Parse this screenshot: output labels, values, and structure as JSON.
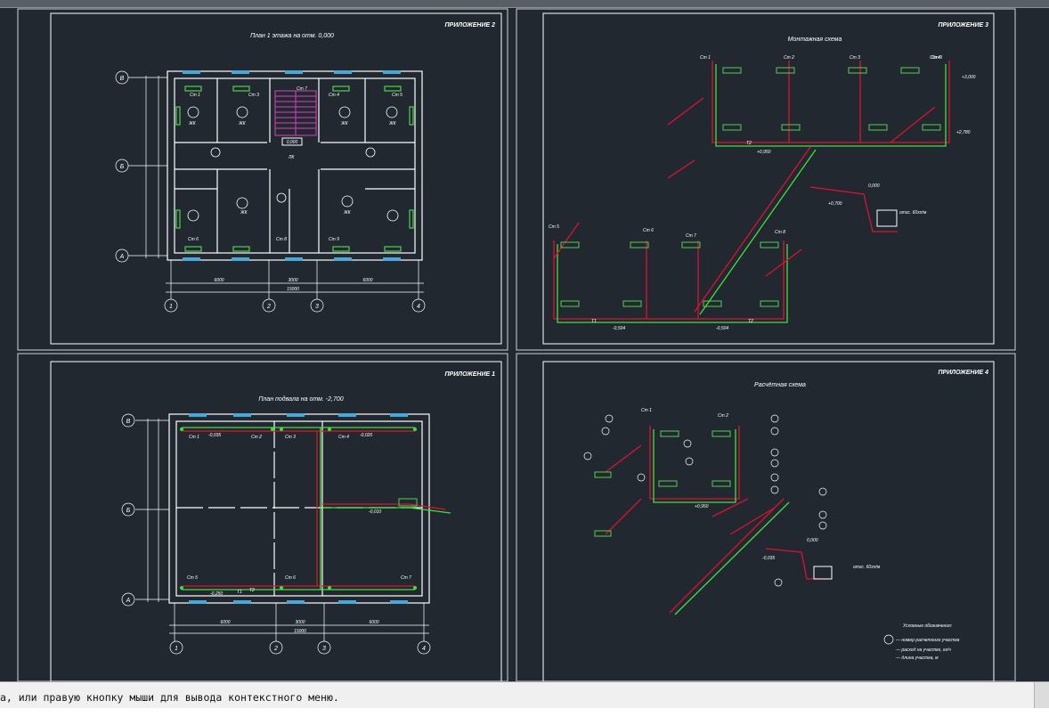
{
  "command_line": {
    "text": "а, или правую кнопку мыши для вывода контекстного меню."
  },
  "colors": {
    "background": "#212830",
    "frame": "#ffffff",
    "wall": "#ffffff",
    "pipe_red": "#e01030",
    "pipe_green": "#40e040",
    "radiator": "#50d050",
    "window": "#4aa8d8",
    "stair": "#e040c0"
  },
  "sheets": {
    "plan1": {
      "label": "ПРИЛОЖЕНИЕ 2",
      "title": "План 1 этажа на отм. 0,000",
      "rows": [
        "В",
        "Б",
        "А"
      ],
      "cols": [
        "1",
        "2",
        "3",
        "4"
      ],
      "dims": [
        "6000",
        "3000",
        "6000",
        "15000"
      ],
      "level": "0,000",
      "rooms": [
        "Ст 1",
        "Ст 3",
        "Ст 7",
        "Ст 4",
        "Ст 5",
        "Ст 6",
        "Ст 8",
        "Ст 9"
      ],
      "room_types": [
        "ЖК",
        "ЖК",
        "ЛК",
        "ЖК",
        "ЖК",
        "ЖК",
        "ЖК"
      ]
    },
    "axono1": {
      "label": "ПРИЛОЖЕНИЕ 3",
      "title": "Монтажная схема",
      "risers": [
        "Ст 1",
        "Ст 2",
        "Ст 3",
        "Ст 4",
        "Ст 5",
        "Ст 6",
        "Ст 7",
        "Ст 8",
        "Ст 9"
      ],
      "marks": [
        "+0,950",
        "-0,504",
        "+0,700",
        "0,000",
        "+2,780",
        "+3,000"
      ],
      "pipe_labels": [
        "Т1",
        "Т2"
      ],
      "note": "отгс. 60хп/м"
    },
    "plan2": {
      "label": "ПРИЛОЖЕНИЕ 1",
      "title": "План подвала на отм. -2,700",
      "rows": [
        "В",
        "Б",
        "А"
      ],
      "cols": [
        "1",
        "2",
        "3",
        "4"
      ],
      "dims": [
        "6000",
        "3000",
        "6000",
        "15000"
      ],
      "rooms": [
        "Ст 1",
        "Ст 2",
        "Ст 3",
        "Ст 4",
        "Ст 5",
        "Ст 6",
        "Ст 7"
      ],
      "marks": [
        "-0,035",
        "-0,020",
        "-0,010",
        "-0,250"
      ],
      "pipe_labels": [
        "Т1",
        "Т2"
      ]
    },
    "axono2": {
      "label": "ПРИЛОЖЕНИЕ 4",
      "title": "Расчётная схема",
      "risers": [
        "Ст 1",
        "Ст 2"
      ],
      "marks": [
        "+0,950",
        "-0,035",
        "0,000"
      ],
      "note": "отгс. 60хп/м",
      "legend_title": "Условные обозначения:",
      "legend_items": [
        "— номер расчетного участка",
        "— расход на участке, кг/ч",
        "— длина участка, м"
      ]
    }
  }
}
